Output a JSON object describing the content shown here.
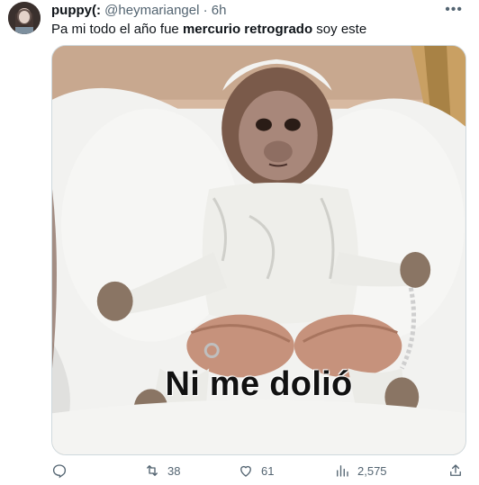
{
  "tweet": {
    "author_name": "puppy(:",
    "handle": "@heymariangel",
    "separator": "·",
    "time": "6h",
    "more_icon": "ellipsis-icon",
    "text_before": "Pa mi todo el año fue ",
    "text_bold": "mercurio retrogrado",
    "text_after": " soy este",
    "image_caption": "Ni me dolió"
  },
  "actions": {
    "reply": {
      "icon": "reply-icon",
      "count": ""
    },
    "retweet": {
      "icon": "retweet-icon",
      "count": "38"
    },
    "like": {
      "icon": "heart-icon",
      "count": "61"
    },
    "views": {
      "icon": "views-icon",
      "count": "2,575"
    },
    "share": {
      "icon": "share-icon",
      "count": ""
    }
  },
  "colors": {
    "text": "#0f1419",
    "secondary": "#536471",
    "border": "#cfd9de"
  }
}
